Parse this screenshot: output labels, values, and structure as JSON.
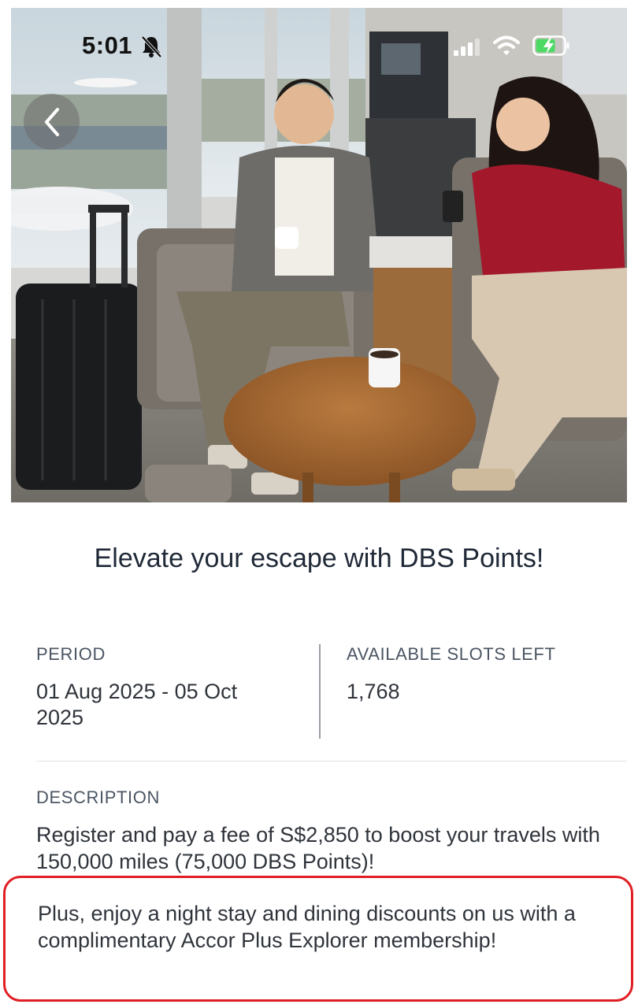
{
  "status_bar": {
    "time": "5:01",
    "icons": [
      "bell-slash-icon",
      "cellular-signal-icon",
      "wifi-icon",
      "battery-charging-icon"
    ],
    "battery_color": "#4cd964"
  },
  "hero": {
    "image": "lounge-photo",
    "back_icon": "chevron-left-icon"
  },
  "content": {
    "title": "Elevate your escape with DBS Points!",
    "period": {
      "label": "PERIOD",
      "value": "01 Aug 2025 - 05 Oct 2025"
    },
    "slots": {
      "label": "AVAILABLE SLOTS LEFT",
      "value": "1,768"
    },
    "description": {
      "label": "DESCRIPTION",
      "paragraph_1": "Register and pay a fee of S$2,850 to boost your travels with 150,000 miles (75,000 DBS Points)!",
      "paragraph_2": "Plus, enjoy a night stay and dining discounts on us with a complimentary Accor Plus Explorer membership!"
    }
  },
  "colors": {
    "highlight_border": "#e01e24",
    "title_text": "#1f2937",
    "body_text": "#2f343b"
  }
}
